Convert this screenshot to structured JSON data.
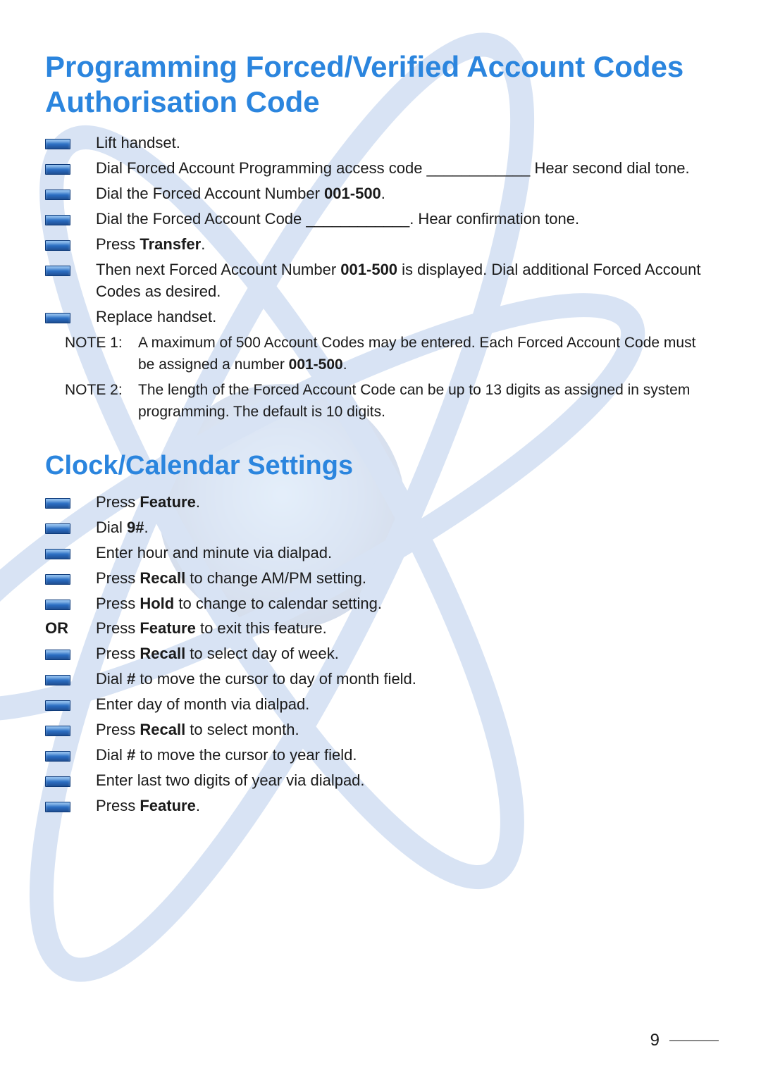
{
  "section1": {
    "title": "Programming Forced/Verified Account Codes Authorisation Code",
    "steps": [
      {
        "type": "bullet",
        "html": "Lift handset."
      },
      {
        "type": "bullet",
        "html": "Dial Forced Account Programming access code ____________ Hear second dial tone."
      },
      {
        "type": "bullet",
        "html": "Dial the Forced Account Number <b>001-500</b>."
      },
      {
        "type": "bullet",
        "html": "Dial the Forced Account Code ____________. Hear confirmation tone."
      },
      {
        "type": "bullet",
        "html": "Press <b>Transfer</b>."
      },
      {
        "type": "bullet",
        "html": "Then next Forced Account Number <b>001-500</b> is displayed. Dial additional Forced Account Codes as desired."
      },
      {
        "type": "bullet",
        "html": "Replace handset."
      }
    ],
    "notes": [
      {
        "label": "NOTE 1:",
        "html": "A maximum of 500 Account Codes may be entered. Each Forced Account Code must be assigned a number <b>001-500</b>."
      },
      {
        "label": "NOTE 2:",
        "html": "The length of the Forced Account Code can be up to 13 digits as assigned in system programming. The default is 10 digits."
      }
    ]
  },
  "section2": {
    "title": "Clock/Calendar Settings",
    "steps": [
      {
        "type": "bullet",
        "html": "Press <b>Feature</b>."
      },
      {
        "type": "bullet",
        "html": "Dial <b>9#</b>."
      },
      {
        "type": "bullet",
        "html": "Enter hour and minute via dialpad."
      },
      {
        "type": "bullet",
        "html": "Press <b>Recall</b> to change AM/PM setting."
      },
      {
        "type": "bullet",
        "html": "Press <b>Hold</b> to change to calendar setting."
      },
      {
        "type": "label",
        "label": "OR",
        "html": "Press <b>Feature</b> to exit this feature."
      },
      {
        "type": "bullet",
        "html": "Press <b>Recall</b> to select day of week."
      },
      {
        "type": "bullet",
        "html": "Dial <b>#</b> to move the cursor to day of month field."
      },
      {
        "type": "bullet",
        "html": "Enter day of month via dialpad."
      },
      {
        "type": "bullet",
        "html": "Press <b>Recall</b> to select month."
      },
      {
        "type": "bullet",
        "html": "Dial <b>#</b> to move the cursor to year field."
      },
      {
        "type": "bullet",
        "html": "Enter last two digits of year via dialpad."
      },
      {
        "type": "bullet",
        "html": "Press <b>Feature</b>."
      }
    ]
  },
  "page_number": "9"
}
